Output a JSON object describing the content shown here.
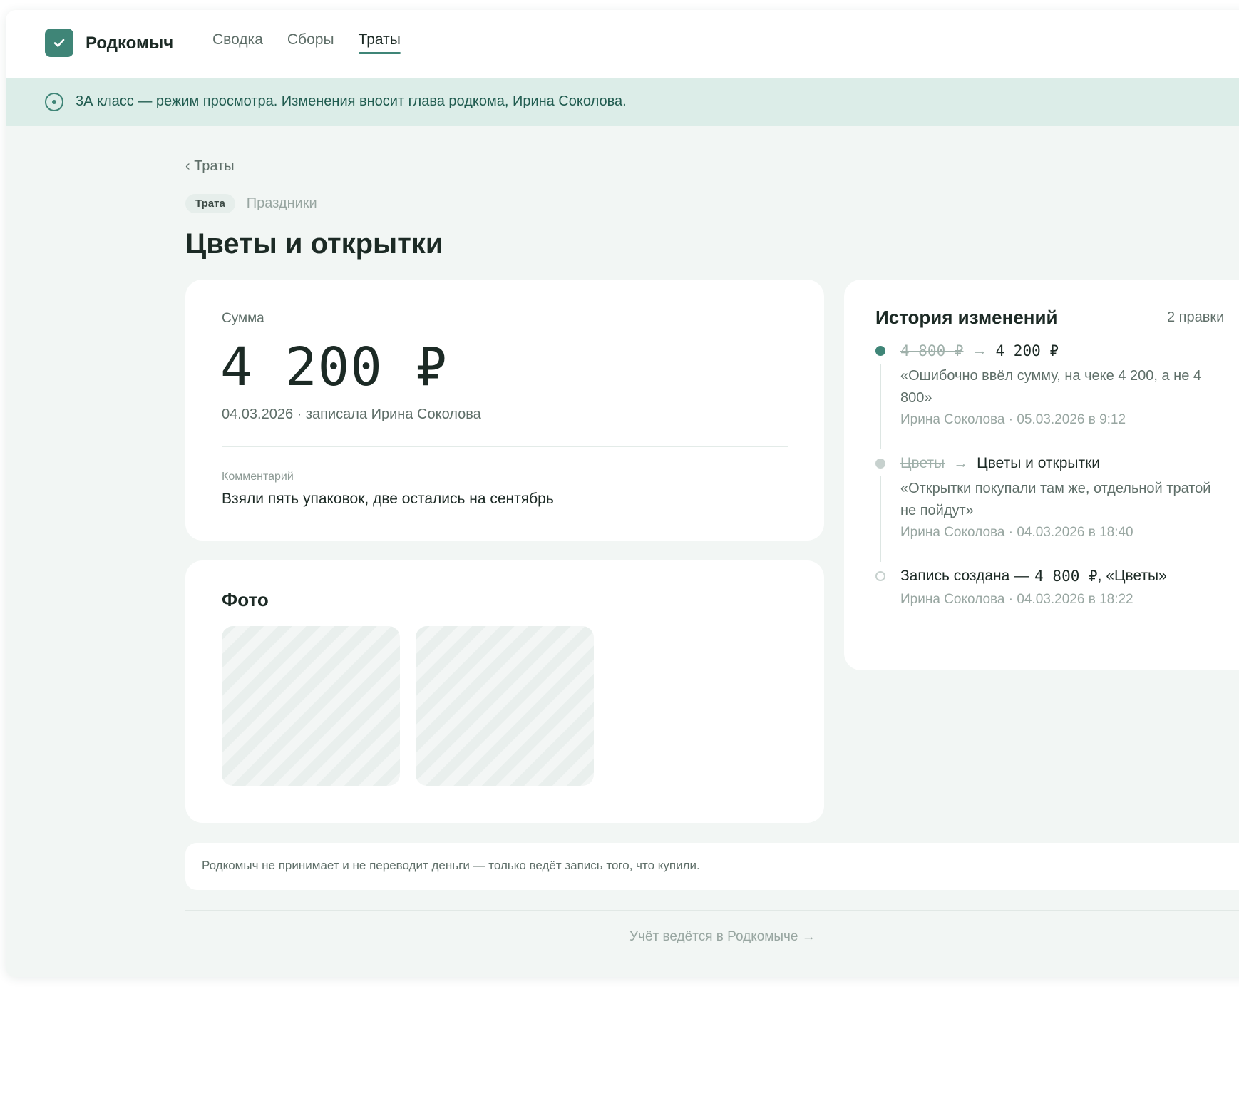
{
  "header": {
    "brand": "Родкомыч",
    "nav": [
      {
        "label": "Сводка",
        "active": false
      },
      {
        "label": "Сборы",
        "active": false
      },
      {
        "label": "Траты",
        "active": true
      }
    ]
  },
  "banner": {
    "text": "3А класс — режим просмотра. Изменения вносит глава родкома, Ирина Соколова."
  },
  "breadcrumb": {
    "back": "‹ Траты"
  },
  "tags": {
    "type": "Трата",
    "category": "Праздники"
  },
  "page_title": "Цветы и открытки",
  "summary": {
    "label": "Сумма",
    "amount": "4 200 ₽",
    "recorded": "04.03.2026 · записала Ирина Соколова",
    "comment_label": "Комментарий",
    "comment": "Взяли пять упаковок, две остались на сентябрь"
  },
  "photos": {
    "title": "Фото",
    "count": 2
  },
  "history": {
    "title": "История изменений",
    "count": "2 правки",
    "items": [
      {
        "old": "4 800 ₽",
        "arrow": "→",
        "new": "4 200 ₽",
        "reason": "«Ошибочно ввёл сумму, на чеке 4 200, а не 4 800»",
        "meta": "Ирина Соколова · 05.03.2026 в 9:12"
      },
      {
        "old": "Цветы",
        "arrow": "→",
        "new": "Цветы и открытки",
        "reason": "«Открытки покупали там же, отдельной тратой не пойдут»",
        "meta": "Ирина Соколова · 04.03.2026 в 18:40"
      },
      {
        "created_prefix": "Запись создана —",
        "created_amount": "4 800 ₽",
        "created_suffix": ", «Цветы»",
        "meta": "Ирина Соколова · 04.03.2026 в 18:22"
      }
    ]
  },
  "notice": "Родкомыч не принимает и не переводит деньги — только ведёт запись того, что купили.",
  "footer_link": "Учёт ведётся в Родкомыче →",
  "colors": {
    "accent": "#3f8577",
    "banner_bg": "#dcede8",
    "page_bg": "#f2f6f4"
  }
}
